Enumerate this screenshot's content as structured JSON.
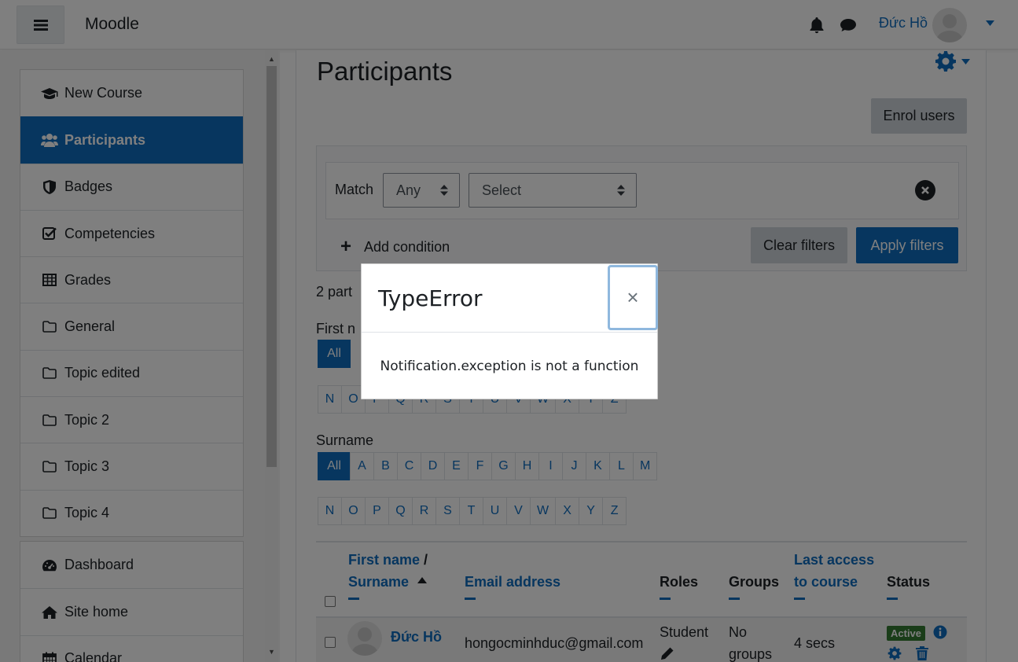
{
  "navbar": {
    "brand": "Moodle",
    "user_name": "Đức Hồ"
  },
  "drawer": {
    "course_items": [
      {
        "label": "New Course",
        "icon": "graduation-cap-icon"
      },
      {
        "label": "Participants",
        "icon": "users-icon",
        "active": true
      },
      {
        "label": "Badges",
        "icon": "shield-icon"
      },
      {
        "label": "Competencies",
        "icon": "check-square-icon"
      },
      {
        "label": "Grades",
        "icon": "table-icon"
      },
      {
        "label": "General",
        "icon": "folder-icon"
      },
      {
        "label": "Topic edited",
        "icon": "folder-icon"
      },
      {
        "label": "Topic 2",
        "icon": "folder-icon"
      },
      {
        "label": "Topic 3",
        "icon": "folder-icon"
      },
      {
        "label": "Topic 4",
        "icon": "folder-icon"
      }
    ],
    "site_items": [
      {
        "label": "Dashboard",
        "icon": "dashboard-icon"
      },
      {
        "label": "Site home",
        "icon": "home-icon"
      },
      {
        "label": "Calendar",
        "icon": "calendar-icon"
      }
    ]
  },
  "main": {
    "title": "Participants",
    "enrol_button": "Enrol users",
    "filter": {
      "match_label": "Match",
      "match_value": "Any",
      "select_value": "Select",
      "add_condition": "Add condition",
      "clear_button": "Clear filters",
      "apply_button": "Apply filters"
    },
    "participants_count_visible": "2 part",
    "firstname_label_visible": "First n",
    "surname_label": "Surname",
    "letters_row1": [
      "All",
      "A",
      "B",
      "C",
      "D",
      "E",
      "F",
      "G",
      "H",
      "I",
      "J",
      "K",
      "L",
      "M"
    ],
    "letters_row2": [
      "N",
      "O",
      "P",
      "Q",
      "R",
      "S",
      "T",
      "U",
      "V",
      "W",
      "X",
      "Y",
      "Z"
    ],
    "table": {
      "headers": {
        "first_name": "First name",
        "separator": "/",
        "surname": "Surname",
        "email": "Email address",
        "roles": "Roles",
        "groups": "Groups",
        "last_access_1": "Last access",
        "last_access_2": "to course",
        "status": "Status"
      },
      "rows": [
        {
          "name": "Đức Hồ",
          "email": "hongocminhduc@gmail.com",
          "role": "Student",
          "groups_1": "No",
          "groups_2": "groups",
          "last_access": "4 secs",
          "status": "Active"
        }
      ]
    }
  },
  "modal": {
    "title": "TypeError",
    "close_glyph": "×",
    "message": "Notification.exception is not a function"
  }
}
